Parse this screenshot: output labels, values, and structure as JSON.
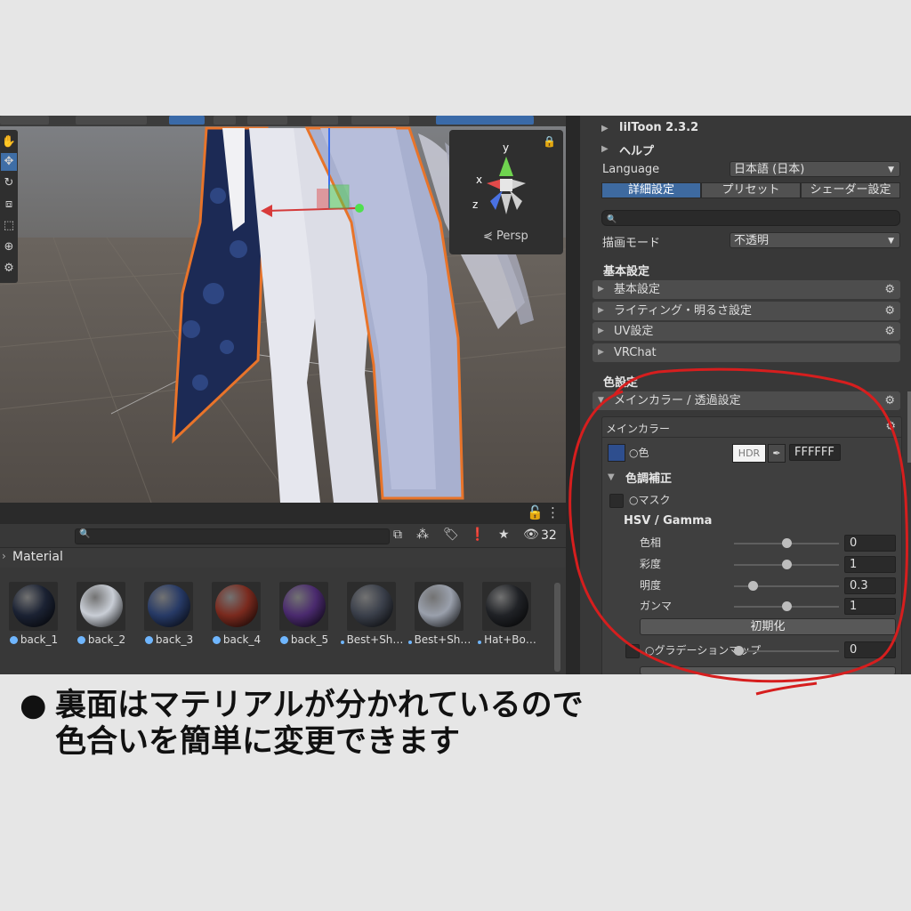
{
  "scene": {
    "view_mode_label": "Persp",
    "gizmo_axes": {
      "x": "x",
      "y": "y",
      "z": "z"
    }
  },
  "project": {
    "hidden_count": "32",
    "breadcrumb": "Material",
    "assets": [
      {
        "label": "back_1",
        "color": "#1b2233"
      },
      {
        "label": "back_2",
        "color": "#c9ced6"
      },
      {
        "label": "back_3",
        "color": "#273a66"
      },
      {
        "label": "back_4",
        "color": "#7a2a1e"
      },
      {
        "label": "back_5",
        "color": "#4a2a6e"
      },
      {
        "label": "Best+Sh…",
        "color": "#3a3f4a"
      },
      {
        "label": "Best+Sh…",
        "color": "#9aa0ac"
      },
      {
        "label": "Hat+Bo…",
        "color": "#202226"
      }
    ]
  },
  "inspector": {
    "shader_title": "lilToon 2.3.2",
    "help_label": "ヘルプ",
    "language_label": "Language",
    "language_value": "日本語 (日本)",
    "tabs": [
      "詳細設定",
      "プリセット",
      "シェーダー設定"
    ],
    "render_mode_label": "描画モード",
    "render_mode_value": "不透明",
    "basic_section": "基本設定",
    "basic_folds": [
      "基本設定",
      "ライティング・明るさ設定",
      "UV設定",
      "VRChat"
    ],
    "color_section": "色設定",
    "main_color_fold": "メインカラー / 透過設定",
    "main_color_box_title": "メインカラー",
    "color_label": "○色",
    "hdr_label": "HDR",
    "hex_value": "FFFFFF",
    "tone_correction_label": "色調補正",
    "mask_label": "○マスク",
    "hsv_label": "HSV / Gamma",
    "sliders": [
      {
        "label": "色相",
        "value": "0",
        "pos": 0.5
      },
      {
        "label": "彩度",
        "value": "1",
        "pos": 0.5
      },
      {
        "label": "明度",
        "value": "0.3",
        "pos": 0.18
      },
      {
        "label": "ガンマ",
        "value": "1",
        "pos": 0.5
      }
    ],
    "reset_button": "初期化",
    "gradation_label": "○グラデーションマップ",
    "gradation_value": "0"
  },
  "caption": {
    "bullet": "●",
    "line1": "裏面はマテリアルが分かれているので",
    "line2": "色合いを簡単に変更できます"
  },
  "colors": {
    "selection_outline": "#e8742a",
    "annotation_red": "#d61e1e",
    "tab_selected": "#3e6aa0"
  }
}
